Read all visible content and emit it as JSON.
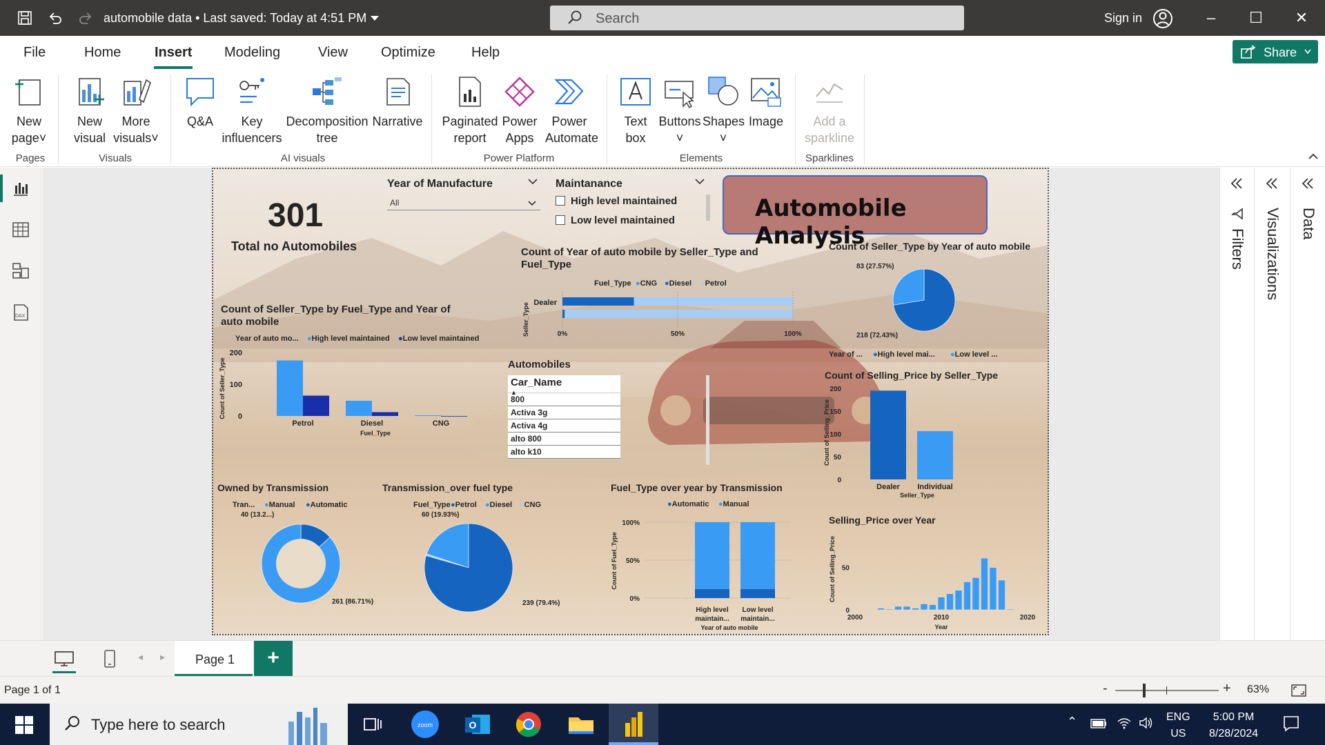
{
  "titlebar": {
    "doc_title": "automobile data • Last saved: Today at 4:51 PM",
    "search_placeholder": "Search",
    "sign_in": "Sign in"
  },
  "menu": {
    "tabs": [
      "File",
      "Home",
      "Insert",
      "Modeling",
      "View",
      "Optimize",
      "Help"
    ],
    "active_tab": "Insert",
    "share_label": "Share"
  },
  "ribbon": {
    "new_page": [
      "New",
      "page"
    ],
    "new_visual": [
      "New",
      "visual"
    ],
    "more_visuals": [
      "More",
      "visuals"
    ],
    "qa": "Q&A",
    "key_influencers": [
      "Key",
      "influencers"
    ],
    "decomposition_tree": [
      "Decomposition",
      "tree"
    ],
    "narrative": "Narrative",
    "paginated_report": [
      "Paginated",
      "report"
    ],
    "power_apps": [
      "Power",
      "Apps"
    ],
    "power_automate": [
      "Power",
      "Automate"
    ],
    "text_box": [
      "Text",
      "box"
    ],
    "buttons": "Buttons",
    "shapes": "Shapes",
    "image": "Image",
    "add_sparkline": [
      "Add a",
      "sparkline"
    ],
    "groups": {
      "pages": "Pages",
      "visuals": "Visuals",
      "ai_visuals": "AI visuals",
      "power_platform": "Power Platform",
      "elements": "Elements",
      "sparklines": "Sparklines"
    }
  },
  "report": {
    "kpi_value": "301",
    "kpi_label": "Total no Automobiles",
    "slicer_year_title": "Year of Manufacture",
    "slicer_year_value": "All",
    "slicer_maint_title": "Maintanance",
    "slicer_maint_options": [
      "High level maintained",
      "Low level maintained"
    ],
    "title_card": "Automobile Analysis",
    "table_title": "Automobiles",
    "table_header": "Car_Name",
    "table_rows": [
      "800",
      "Activa 3g",
      "Activa 4g",
      "alto 800",
      "alto k10"
    ]
  },
  "colors": {
    "accent": "#117865",
    "series_dark": "#1565c0",
    "series_light": "#3a9bf5",
    "series_navy": "#1a2ea8",
    "series_pale": "#a6cdf5",
    "title_card": "#b87a74"
  },
  "chart_data": [
    {
      "type": "bar",
      "title": "Count of Seller_Type by Fuel_Type and Year of auto mobile",
      "legend_title": "Year of auto mo...",
      "categories": [
        "Petrol",
        "Diesel",
        "CNG"
      ],
      "series": [
        {
          "name": "High level maintained",
          "values": [
            175,
            48,
            2
          ]
        },
        {
          "name": "Low level maintained",
          "values": [
            64,
            12,
            0
          ]
        }
      ],
      "xlabel": "Fuel_Type",
      "ylabel": "Count of Seller_Type",
      "yticks": [
        "200",
        "100",
        "0"
      ],
      "ylim": [
        0,
        200
      ]
    },
    {
      "type": "bar",
      "title": "Count of Year of auto mobile by Seller_Type and Fuel_Type",
      "legend_title": "Fuel_Type",
      "legend": [
        "CNG",
        "Diesel",
        "Petrol"
      ],
      "categories": [
        "Dealer",
        ""
      ],
      "series": [
        {
          "name": "CNG",
          "values": [
            0,
            0
          ]
        },
        {
          "name": "Diesel",
          "values": [
            0.31,
            0.01
          ]
        },
        {
          "name": "Petrol",
          "values": [
            0.69,
            0.99
          ]
        }
      ],
      "ylabel": "Seller_Type",
      "xticks": [
        "0%",
        "50%",
        "100%"
      ]
    },
    {
      "type": "pie",
      "title": "Count of Seller_Type by Year of auto mobile",
      "legend_title": "Year of ...",
      "legend": [
        "High level mai...",
        "Low level ..."
      ],
      "values": [
        218,
        83
      ],
      "labels": [
        "218 (72.43%)",
        "83 (27.57%)"
      ]
    },
    {
      "type": "bar",
      "title": "Count of Selling_Price by Seller_Type",
      "categories": [
        "Dealer",
        "Individual"
      ],
      "values": [
        195,
        106
      ],
      "xlabel": "Seller_Type",
      "ylabel": "Count of Selling_Price",
      "yticks": [
        "200",
        "150",
        "100",
        "50",
        "0"
      ],
      "ylim": [
        0,
        200
      ]
    },
    {
      "type": "pie",
      "title": "Owned by Transmission",
      "legend_title": "Tran...",
      "legend": [
        "Manual",
        "Automatic"
      ],
      "values": [
        261,
        40
      ],
      "labels": [
        "261 (86.71%)",
        "40 (13.2...)"
      ]
    },
    {
      "type": "pie",
      "title": "Transmission_over fuel type",
      "legend_title": "Fuel_Type",
      "legend": [
        "Petrol",
        "Diesel",
        "CNG"
      ],
      "values": [
        239,
        60,
        2
      ],
      "labels": [
        "239 (79.4%)",
        "60 (19.93%)"
      ]
    },
    {
      "type": "bar",
      "title": "Fuel_Type over year by Transmission",
      "legend": [
        "Automatic",
        "Manual"
      ],
      "categories": [
        "High level maintain...",
        "Low level maintain..."
      ],
      "series": [
        {
          "name": "Manual",
          "values": [
            0.88,
            0.88
          ]
        },
        {
          "name": "Automatic",
          "values": [
            0.12,
            0.12
          ]
        }
      ],
      "xlabel": "Year of auto mobile",
      "ylabel": "Count of Fuel_Type",
      "yticks": [
        "100%",
        "50%",
        "0%"
      ]
    },
    {
      "type": "bar",
      "title": "Selling_Price over Year",
      "x": [
        2003,
        2004,
        2005,
        2006,
        2007,
        2008,
        2009,
        2010,
        2011,
        2012,
        2013,
        2014,
        2015,
        2016,
        2017,
        2018
      ],
      "values": [
        2,
        1,
        4,
        4,
        2,
        7,
        6,
        15,
        19,
        23,
        33,
        38,
        61,
        50,
        35,
        1
      ],
      "xlabel": "Year",
      "ylabel": "Count of Selling_Price",
      "xticks": [
        "2000",
        "2010",
        "2020"
      ],
      "yticks": [
        "50",
        "0"
      ],
      "ylim": [
        0,
        70
      ]
    }
  ],
  "panes": {
    "filters": "Filters",
    "visualizations": "Visualizations",
    "data": "Data"
  },
  "pages": {
    "tab": "Page 1",
    "add": "+"
  },
  "status": {
    "page_count": "Page 1 of 1",
    "zoom": "63%"
  },
  "taskbar": {
    "search_placeholder": "Type here to search",
    "lang": [
      "ENG",
      "US"
    ],
    "time": "5:00 PM",
    "date": "8/28/2024"
  }
}
